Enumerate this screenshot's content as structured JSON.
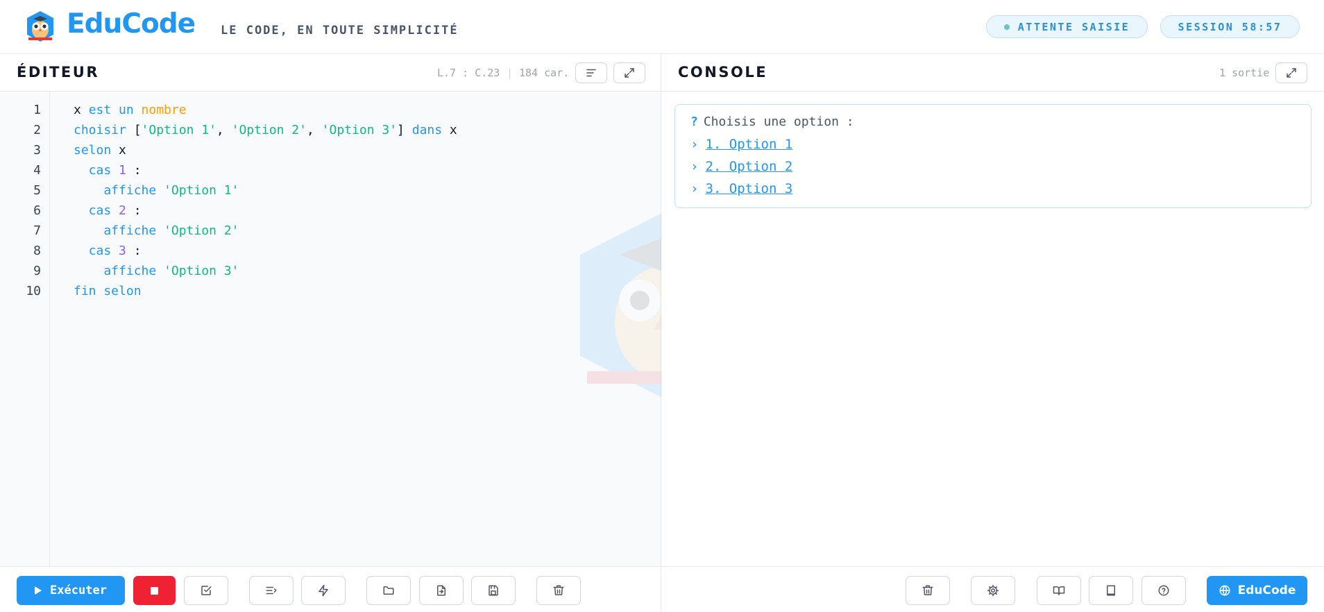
{
  "header": {
    "brand": "EduCode",
    "tagline": "LE CODE, EN TOUTE SIMPLICITÉ",
    "status": "ATTENTE SAISIE",
    "session": "SESSION 58:57",
    "accent": "#2196f3"
  },
  "editor": {
    "title": "ÉDITEUR",
    "cursor": "L.7 : C.23",
    "chars": "184 car.",
    "line_numbers": [
      "1",
      "2",
      "3",
      "4",
      "5",
      "6",
      "7",
      "8",
      "9",
      "10"
    ],
    "lines": [
      [
        {
          "t": "x ",
          "c": ""
        },
        {
          "t": "est un ",
          "c": "kw"
        },
        {
          "t": "nombre",
          "c": "ty"
        }
      ],
      [
        {
          "t": "choisir ",
          "c": "kw"
        },
        {
          "t": "[",
          "c": ""
        },
        {
          "t": "'Option 1'",
          "c": "st"
        },
        {
          "t": ", ",
          "c": ""
        },
        {
          "t": "'Option 2'",
          "c": "st"
        },
        {
          "t": ", ",
          "c": ""
        },
        {
          "t": "'Option 3'",
          "c": "st"
        },
        {
          "t": "] ",
          "c": ""
        },
        {
          "t": "dans ",
          "c": "kw"
        },
        {
          "t": "x",
          "c": ""
        }
      ],
      [
        {
          "t": "selon ",
          "c": "kw"
        },
        {
          "t": "x",
          "c": ""
        }
      ],
      [
        {
          "t": "  cas ",
          "c": "kw"
        },
        {
          "t": "1",
          "c": "nm"
        },
        {
          "t": " :",
          "c": ""
        }
      ],
      [
        {
          "t": "    affiche ",
          "c": "kw"
        },
        {
          "t": "'Option 1'",
          "c": "st"
        }
      ],
      [
        {
          "t": "  cas ",
          "c": "kw"
        },
        {
          "t": "2",
          "c": "nm"
        },
        {
          "t": " :",
          "c": ""
        }
      ],
      [
        {
          "t": "    affiche ",
          "c": "kw"
        },
        {
          "t": "'Option 2'",
          "c": "st"
        }
      ],
      [
        {
          "t": "  cas ",
          "c": "kw"
        },
        {
          "t": "3",
          "c": "nm"
        },
        {
          "t": " :",
          "c": ""
        }
      ],
      [
        {
          "t": "    affiche ",
          "c": "kw"
        },
        {
          "t": "'Option 3'",
          "c": "st"
        }
      ],
      [
        {
          "t": "fin selon",
          "c": "kw"
        }
      ]
    ],
    "run_label": "Exécuter"
  },
  "console": {
    "title": "CONSOLE",
    "count": "1 sortie",
    "prompt_mark": "?",
    "prompt": "Choisis une option :",
    "options": [
      "1. Option 1",
      "2. Option 2",
      "3. Option 3"
    ],
    "brand_button": "EduCode"
  },
  "icons": {
    "format": "lines-icon",
    "expand": "expand-icon",
    "check": "checkbox-icon",
    "indent": "indent-icon",
    "flash": "lightning-icon",
    "folder": "folder-icon",
    "import": "file-import-icon",
    "save": "save-icon",
    "trash": "trash-icon",
    "settings": "gear-icon",
    "open-book": "book-open-icon",
    "book": "book-icon",
    "help": "help-icon",
    "globe": "globe-icon"
  }
}
